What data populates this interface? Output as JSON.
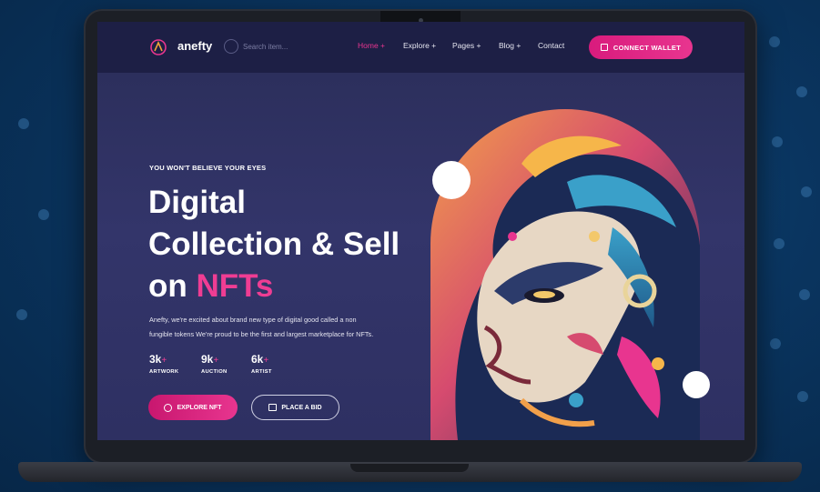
{
  "nav": {
    "brand": "anefty",
    "search_placeholder": "Search item...",
    "items": [
      "Home +",
      "Explore +",
      "Pages +",
      "Blog +",
      "Contact"
    ],
    "active_index": 0,
    "cta": "CONNECT WALLET"
  },
  "hero": {
    "eyebrow": "YOU WON'T BELIEVE YOUR EYES",
    "title_line1": "Digital",
    "title_line2": "Collection & Sell",
    "title_line3_prefix": "on",
    "title_highlight": "NFTs",
    "description_line1": "Anefty, we're excited about brand new type of digital good called a non",
    "description_line2": "fungible tokens We're proud to be the first and largest marketplace for NFTs.",
    "stats": [
      {
        "value": "3k",
        "plus": "+",
        "label": "ARTWORK"
      },
      {
        "value": "9k",
        "plus": "+",
        "label": "AUCTION"
      },
      {
        "value": "6k",
        "plus": "+",
        "label": "ARTIST"
      }
    ],
    "primary_button": "EXPLORE NFT",
    "secondary_button": "PLACE A BID"
  },
  "colors": {
    "accent": "#e8358f",
    "nav_bg": "#1d1f45",
    "screen_bg": "#2e3062"
  },
  "icons": {
    "logo": "anefty-logo-icon",
    "search": "search-icon",
    "wallet": "wallet-icon",
    "explore": "compass-icon",
    "bid": "gavel-icon"
  }
}
